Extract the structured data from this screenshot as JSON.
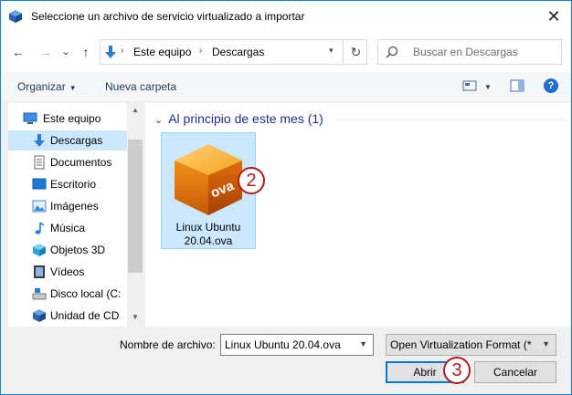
{
  "window": {
    "title": "Seleccione un archivo de servicio virtualizado a importar",
    "close": "✕"
  },
  "nav": {
    "back": "←",
    "forward": "→",
    "recent": "⌄",
    "up": "↑",
    "breadcrumb": [
      "Este equipo",
      "Descargas"
    ],
    "separator": "›",
    "refresh": "↻",
    "search_placeholder": "Buscar en Descargas"
  },
  "toolbar": {
    "organize": "Organizar",
    "new_folder": "Nueva carpeta",
    "help": "?"
  },
  "sidebar": {
    "items": [
      {
        "label": "Este equipo",
        "icon": "computer-icon"
      },
      {
        "label": "Descargas",
        "icon": "downloads-icon",
        "selected": true
      },
      {
        "label": "Documentos",
        "icon": "documents-icon"
      },
      {
        "label": "Escritorio",
        "icon": "desktop-icon"
      },
      {
        "label": "Imágenes",
        "icon": "pictures-icon"
      },
      {
        "label": "Música",
        "icon": "music-icon"
      },
      {
        "label": "Objetos 3D",
        "icon": "3d-objects-icon"
      },
      {
        "label": "Vídeos",
        "icon": "videos-icon"
      },
      {
        "label": "Disco local (C:",
        "icon": "local-disk-icon"
      },
      {
        "label": "Unidad de CD",
        "icon": "cd-drive-icon"
      }
    ]
  },
  "content": {
    "group_header": "Al principio de este mes (1)",
    "files": [
      {
        "name_line1": "Linux Ubuntu",
        "name_line2": "20.04.ova",
        "icon": "ova-box-icon",
        "icon_text": "ova"
      }
    ]
  },
  "bottom": {
    "filename_label": "Nombre de archivo:",
    "filename_value": "Linux Ubuntu 20.04.ova",
    "filter_value": "Open Virtualization Format (*",
    "open_button": "Abrir",
    "cancel_button": "Cancelar"
  },
  "annotations": {
    "step2": "2",
    "step3": "3"
  },
  "colors": {
    "accent": "#0078d7",
    "selected_bg": "#cce8ff",
    "callout": "#b01c1c",
    "header_blue": "#1e3287"
  }
}
